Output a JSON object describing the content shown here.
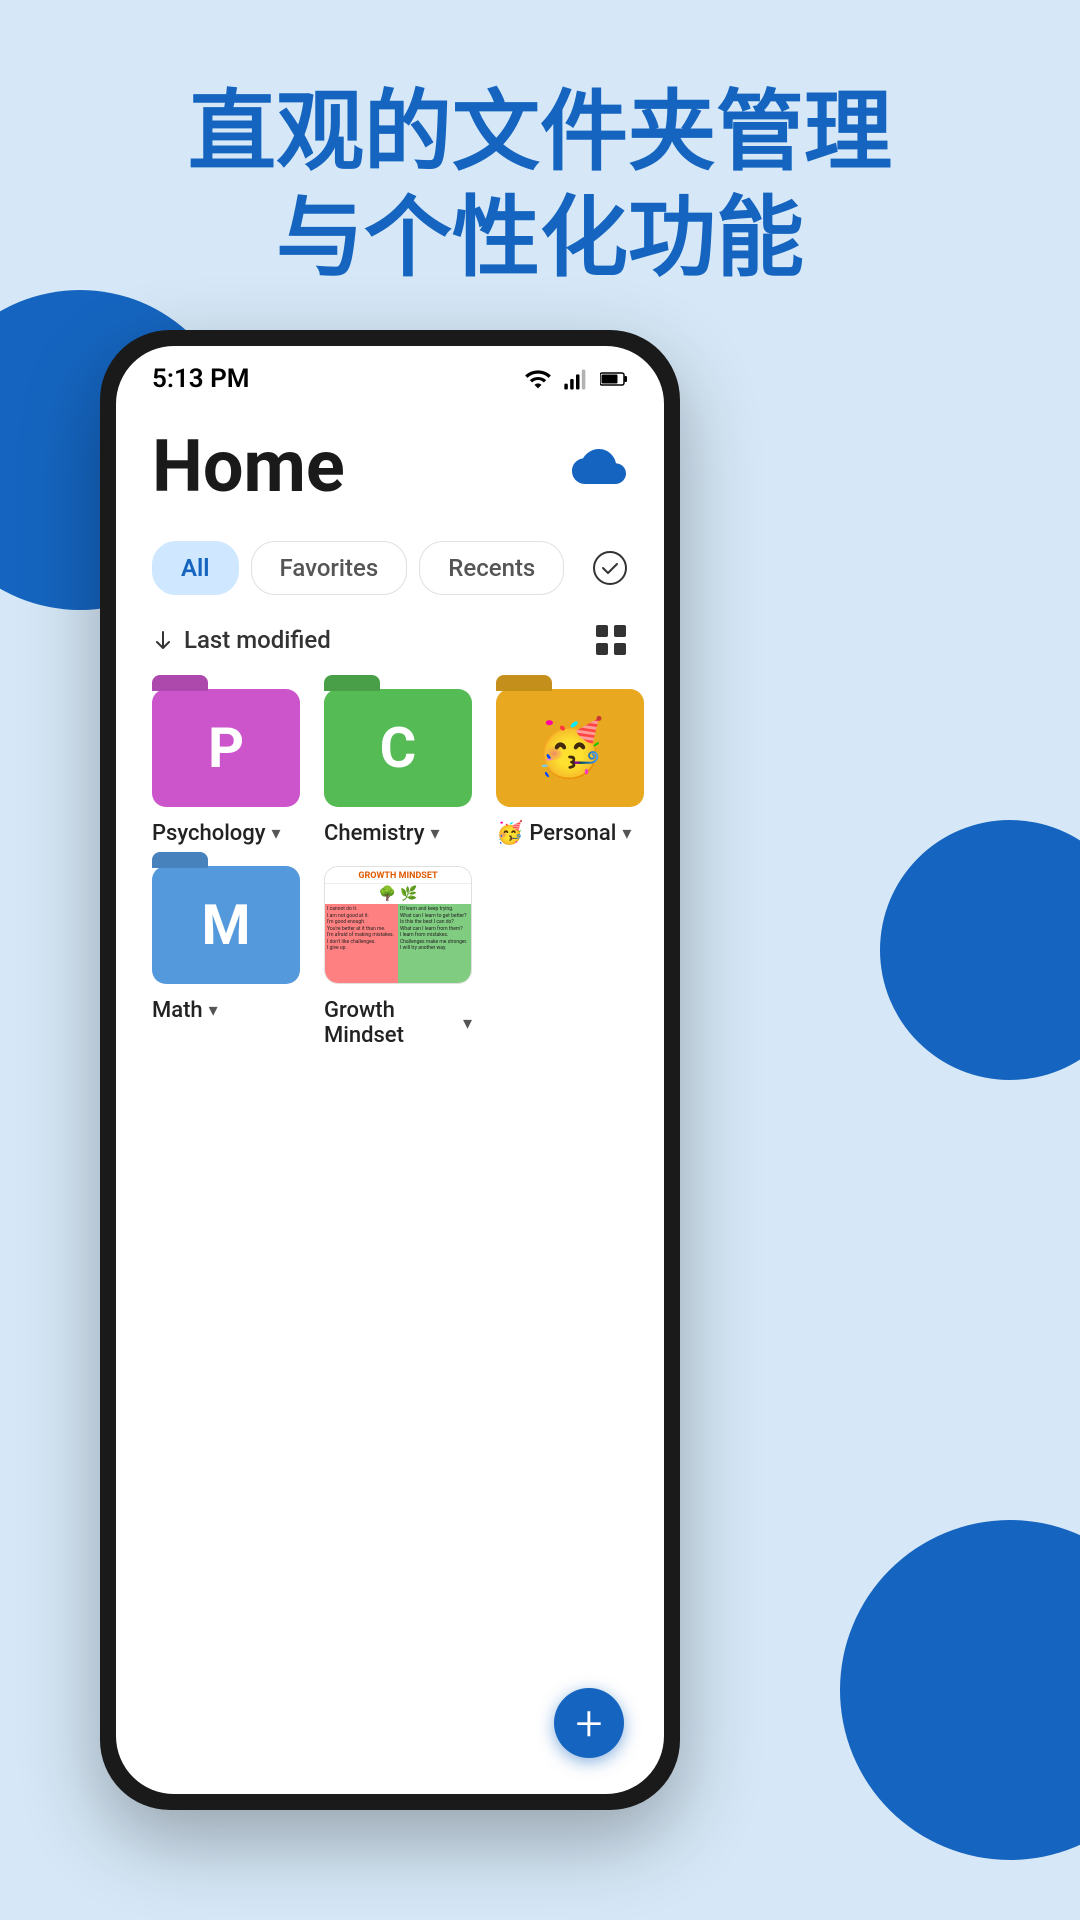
{
  "page": {
    "background_color": "#d6e8f7",
    "heading_line1": "直观的文件夹管理",
    "heading_line2": "与个性化功能",
    "heading_color": "#1565c0"
  },
  "status_bar": {
    "time": "5:13 PM"
  },
  "app": {
    "title": "Home",
    "cloud_label": "cloud-sync",
    "tabs": [
      {
        "id": "all",
        "label": "All",
        "active": true
      },
      {
        "id": "favorites",
        "label": "Favorites",
        "active": false
      },
      {
        "id": "recents",
        "label": "Recents",
        "active": false
      }
    ],
    "sort_label": "Last modified",
    "folders_row1": [
      {
        "id": "psychology",
        "label": "Psychology",
        "letter": "P",
        "color": "purple",
        "emoji": ""
      },
      {
        "id": "chemistry",
        "label": "Chemistry",
        "letter": "C",
        "color": "green",
        "emoji": ""
      },
      {
        "id": "personal",
        "label": "Personal",
        "letter": "🥳",
        "color": "yellow",
        "emoji": "🥳"
      }
    ],
    "folders_row2": [
      {
        "id": "math",
        "label": "Math",
        "letter": "M",
        "color": "blue",
        "emoji": ""
      },
      {
        "id": "growth-mindset",
        "label": "Growth Mindset",
        "letter": "",
        "color": "image",
        "emoji": ""
      }
    ],
    "fab_label": "+"
  }
}
